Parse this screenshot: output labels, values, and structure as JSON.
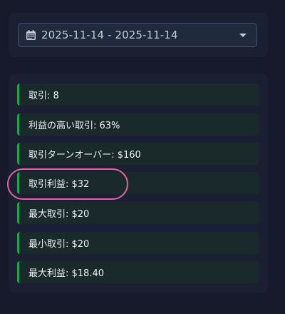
{
  "date_range": {
    "icon": "calendar-icon",
    "value": "2025-11-14 - 2025-11-14"
  },
  "stats": {
    "items": [
      {
        "label": "取引: 8"
      },
      {
        "label": "利益の高い取引: 63%"
      },
      {
        "label": "取引ターンオーバー: $160"
      },
      {
        "label": "取引利益: $32"
      },
      {
        "label": "最大取引: $20"
      },
      {
        "label": "最小取引: $20"
      },
      {
        "label": "最大利益: $18.40"
      }
    ]
  },
  "colors": {
    "background": "#161a2b",
    "panel": "#1a2032",
    "item_background": "#1a2a2b",
    "item_accent": "#1aa84e",
    "highlight": "#e0659b"
  }
}
